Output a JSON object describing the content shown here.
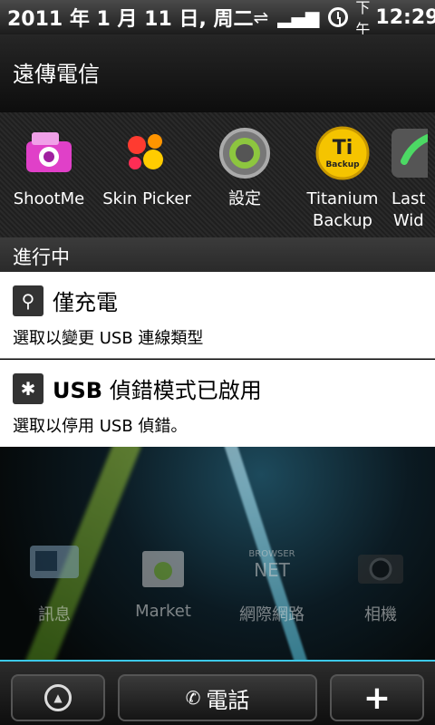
{
  "status_bar": {
    "date": "2011 年 1 月 11 日, 周二",
    "ampm": "下午",
    "time": "12:29",
    "icons": [
      "usb-icon",
      "signal-icon",
      "alarm-clock-icon"
    ]
  },
  "header": {
    "carrier": "遠傳電信"
  },
  "apps": [
    {
      "label": "ShootMe",
      "icon": "camera-icon"
    },
    {
      "label": "Skin Picker",
      "icon": "paint-splash-icon"
    },
    {
      "label": "設定",
      "icon": "gear-icon"
    },
    {
      "label": "Titanium\nBackup",
      "label_line1": "Titanium",
      "label_line2": "Backup",
      "icon": "titanium-backup-icon",
      "badge": "Ti",
      "badge_sub": "Backup"
    },
    {
      "label": "Last\nWid",
      "label_line1": "Last",
      "label_line2": "Wid",
      "icon": "phone-icon"
    }
  ],
  "section": {
    "title": "進行中"
  },
  "notifications": [
    {
      "icon": "usb-icon",
      "title": "僅充電",
      "subtitle": "選取以變更 USB 連線類型"
    },
    {
      "icon": "android-bug-icon",
      "title_bold": "USB",
      "title_rest": " 偵錯模式已啟用",
      "subtitle": "選取以停用 USB 偵錯。"
    }
  ],
  "home": {
    "dock": [
      {
        "label": "訊息",
        "icon": "message-icon"
      },
      {
        "label": "Market",
        "icon": "market-icon"
      },
      {
        "label": "網際網路",
        "icon": "browser-icon",
        "badge_top": "BROWSER",
        "badge_bottom": "NET"
      },
      {
        "label": "相機",
        "icon": "camera-icon"
      }
    ],
    "phone_label": "電話"
  },
  "colors": {
    "accent": "#3cc8e8",
    "header_bg": "#1c1c1c"
  }
}
